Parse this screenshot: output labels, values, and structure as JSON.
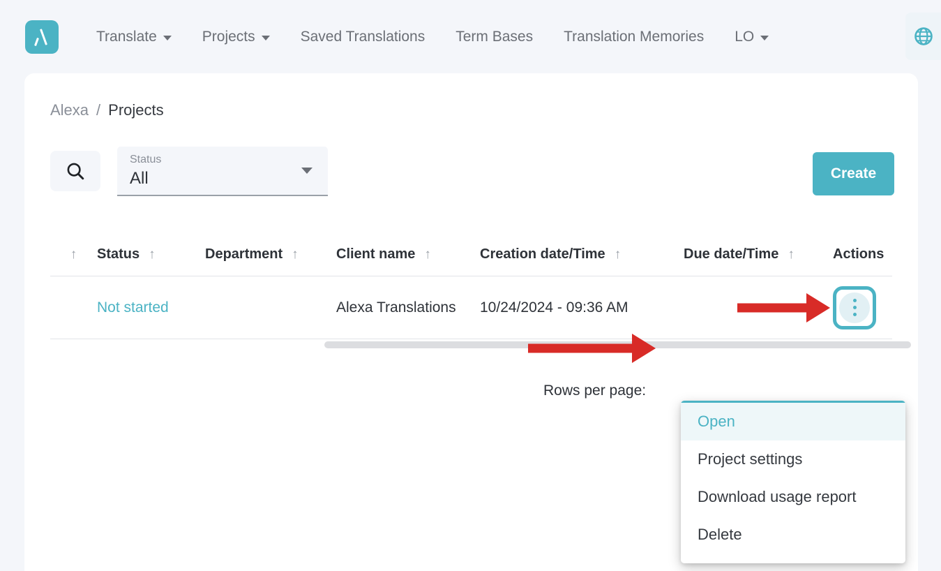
{
  "topbar": {
    "logo_icon": "lambda-logo-icon",
    "nav_items": [
      {
        "label": "Translate",
        "has_caret": true
      },
      {
        "label": "Projects",
        "has_caret": true
      },
      {
        "label": "Saved Translations",
        "has_caret": false
      },
      {
        "label": "Term Bases",
        "has_caret": false
      },
      {
        "label": "Translation Memories",
        "has_caret": false
      },
      {
        "label": "LO",
        "has_caret": true
      }
    ],
    "globe_icon": "globe-icon"
  },
  "breadcrumb": {
    "root": "Alexa",
    "separator": "/",
    "current": "Projects"
  },
  "toolbar": {
    "search_icon": "search-icon",
    "status_filter": {
      "label": "Status",
      "value": "All",
      "caret_icon": "chevron-down-icon"
    },
    "create_label": "Create"
  },
  "table": {
    "sort_arrow": "↑",
    "columns": [
      {
        "label": "",
        "sortable": true
      },
      {
        "label": "Status",
        "sortable": true
      },
      {
        "label": "Department",
        "sortable": true
      },
      {
        "label": "Client name",
        "sortable": true
      },
      {
        "label": "Creation date/Time",
        "sortable": true
      },
      {
        "label": "Due date/Time",
        "sortable": true
      },
      {
        "label": "Actions",
        "sortable": false
      }
    ],
    "rows": [
      {
        "select": "",
        "status": "Not started",
        "department": "",
        "client_name": "Alexa Translations",
        "creation_datetime": "10/24/2024 - 09:36 AM",
        "due_datetime": "",
        "actions_icon": "three-dots-vertical-icon"
      }
    ]
  },
  "pagination": {
    "rows_per_page_label": "Rows per page:"
  },
  "context_menu": {
    "items": [
      {
        "label": "Open",
        "active": true
      },
      {
        "label": "Project settings",
        "active": false
      },
      {
        "label": "Download usage report",
        "active": false
      },
      {
        "label": "Delete",
        "active": false
      }
    ]
  },
  "annotations": {
    "arrow_color": "#d82b27",
    "highlight_color": "#4bb3c4"
  },
  "colors": {
    "accent": "#4bb3c4",
    "page_background": "#f4f6fa",
    "panel_background": "#ffffff",
    "text_primary": "#2e3238",
    "text_muted": "#8a8f98"
  }
}
